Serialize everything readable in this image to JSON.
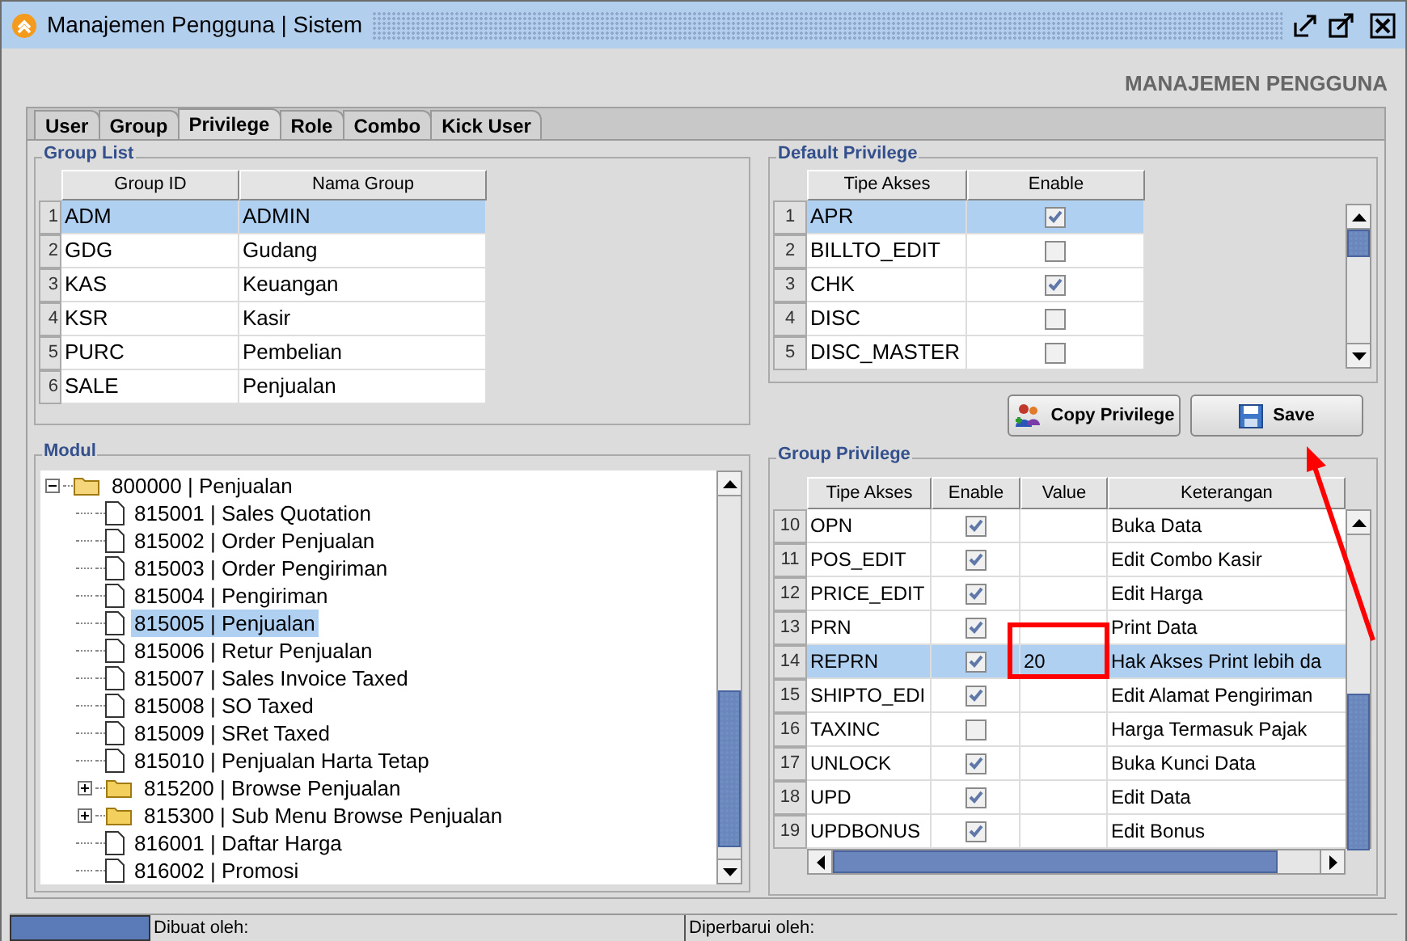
{
  "window": {
    "title": "Manajemen Pengguna | Sistem"
  },
  "heading": "MANAJEMEN PENGGUNA",
  "tabs": [
    {
      "label": "User",
      "selected": false
    },
    {
      "label": "Group",
      "selected": false
    },
    {
      "label": "Privilege",
      "selected": true
    },
    {
      "label": "Role",
      "selected": false
    },
    {
      "label": "Combo",
      "selected": false
    },
    {
      "label": "Kick User",
      "selected": false
    }
  ],
  "group_list": {
    "title": "Group List",
    "columns": [
      "Group ID",
      "Nama Group"
    ],
    "rows": [
      {
        "num": "1",
        "cells": [
          "ADM",
          "ADMIN"
        ],
        "selected": true
      },
      {
        "num": "2",
        "cells": [
          "GDG",
          "Gudang"
        ],
        "selected": false
      },
      {
        "num": "3",
        "cells": [
          "KAS",
          "Keuangan"
        ],
        "selected": false
      },
      {
        "num": "4",
        "cells": [
          "KSR",
          "Kasir"
        ],
        "selected": false
      },
      {
        "num": "5",
        "cells": [
          "PURC",
          "Pembelian"
        ],
        "selected": false
      },
      {
        "num": "6",
        "cells": [
          "SALE",
          "Penjualan"
        ],
        "selected": false
      }
    ]
  },
  "default_privilege": {
    "title": "Default Privilege",
    "columns": [
      "Tipe Akses",
      "Enable"
    ],
    "rows": [
      {
        "num": "1",
        "tipe": "APR",
        "enable": true,
        "selected": true
      },
      {
        "num": "2",
        "tipe": "BILLTO_EDIT",
        "enable": false,
        "selected": false
      },
      {
        "num": "3",
        "tipe": "CHK",
        "enable": true,
        "selected": false
      },
      {
        "num": "4",
        "tipe": "DISC",
        "enable": false,
        "selected": false
      },
      {
        "num": "5",
        "tipe": "DISC_MASTER",
        "enable": false,
        "selected": false
      }
    ]
  },
  "buttons": [
    {
      "label": "Copy Privilege",
      "kind": "copy"
    },
    {
      "label": "Save",
      "kind": "save"
    }
  ],
  "modul": {
    "title": "Modul",
    "tree": [
      {
        "label": "800000 | Penjualan",
        "kind": "folder",
        "expanded": true,
        "selected": false,
        "children": [
          {
            "label": "815001 | Sales Quotation",
            "kind": "file",
            "selected": false
          },
          {
            "label": "815002 | Order Penjualan",
            "kind": "file",
            "selected": false
          },
          {
            "label": "815003 | Order Pengiriman",
            "kind": "file",
            "selected": false
          },
          {
            "label": "815004 | Pengiriman",
            "kind": "file",
            "selected": false
          },
          {
            "label": "815005 | Penjualan",
            "kind": "file",
            "selected": true
          },
          {
            "label": "815006 | Retur Penjualan",
            "kind": "file",
            "selected": false
          },
          {
            "label": "815007 | Sales Invoice Taxed",
            "kind": "file",
            "selected": false
          },
          {
            "label": "815008 | SO Taxed",
            "kind": "file",
            "selected": false
          },
          {
            "label": "815009 | SRet Taxed",
            "kind": "file",
            "selected": false
          },
          {
            "label": "815010 | Penjualan Harta Tetap",
            "kind": "file",
            "selected": false
          },
          {
            "label": "815200 | Browse Penjualan",
            "kind": "folder",
            "expanded": false,
            "selected": false
          },
          {
            "label": "815300 | Sub Menu Browse Penjualan",
            "kind": "folder",
            "expanded": false,
            "selected": false
          },
          {
            "label": "816001 | Daftar Harga",
            "kind": "file",
            "selected": false
          },
          {
            "label": "816002 | Promosi",
            "kind": "file",
            "selected": false
          }
        ]
      }
    ]
  },
  "group_privilege": {
    "title": "Group Privilege",
    "columns": [
      "Tipe Akses",
      "Enable",
      "Value",
      "Keterangan"
    ],
    "rows": [
      {
        "num": "10",
        "tipe": "OPN",
        "enable": true,
        "value": "",
        "keterangan": "Buka Data",
        "selected": false
      },
      {
        "num": "11",
        "tipe": "POS_EDIT",
        "enable": true,
        "value": "",
        "keterangan": "Edit Combo Kasir",
        "selected": false
      },
      {
        "num": "12",
        "tipe": "PRICE_EDIT",
        "enable": true,
        "value": "",
        "keterangan": "Edit Harga",
        "selected": false
      },
      {
        "num": "13",
        "tipe": "PRN",
        "enable": true,
        "value": "",
        "keterangan": "Print Data",
        "selected": false
      },
      {
        "num": "14",
        "tipe": "REPRN",
        "enable": true,
        "value": "20",
        "keterangan": "Hak Akses Print lebih da",
        "selected": true
      },
      {
        "num": "15",
        "tipe": "SHIPTO_EDI",
        "enable": true,
        "value": "",
        "keterangan": "Edit Alamat Pengiriman",
        "selected": false
      },
      {
        "num": "16",
        "tipe": "TAXINC",
        "enable": false,
        "value": "",
        "keterangan": "Harga Termasuk Pajak",
        "selected": false
      },
      {
        "num": "17",
        "tipe": "UNLOCK",
        "enable": true,
        "value": "",
        "keterangan": "Buka Kunci Data",
        "selected": false
      },
      {
        "num": "18",
        "tipe": "UPD",
        "enable": true,
        "value": "",
        "keterangan": "Edit Data",
        "selected": false
      },
      {
        "num": "19",
        "tipe": "UPDBONUS",
        "enable": true,
        "value": "",
        "keterangan": "Edit Bonus",
        "selected": false
      }
    ]
  },
  "status_bar": {
    "created": "Dibuat oleh:",
    "updated": "Diperbarui oleh:"
  }
}
